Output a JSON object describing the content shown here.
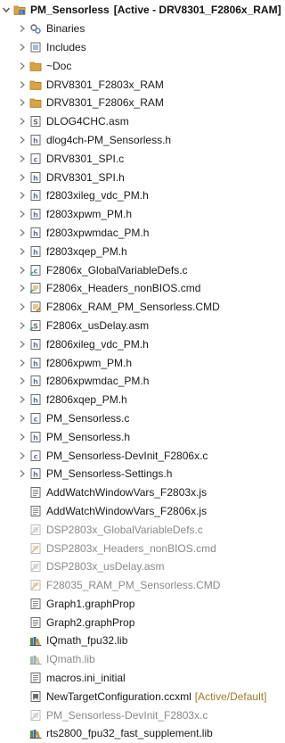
{
  "project": {
    "name": "PM_Sensorless",
    "status": "[Active - DRV8301_F2806x_RAM]",
    "icon": "project-icon"
  },
  "items": [
    {
      "label": "Binaries",
      "icon": "binaries-icon",
      "chevron": true,
      "ghost": false,
      "suffix": ""
    },
    {
      "label": "Includes",
      "icon": "includes-icon",
      "chevron": true,
      "ghost": false,
      "suffix": ""
    },
    {
      "label": "~Doc",
      "icon": "folder-icon",
      "chevron": true,
      "ghost": false,
      "suffix": ""
    },
    {
      "label": "DRV8301_F2803x_RAM",
      "icon": "folder-icon",
      "chevron": true,
      "ghost": false,
      "suffix": ""
    },
    {
      "label": "DRV8301_F2806x_RAM",
      "icon": "folder-icon",
      "chevron": true,
      "ghost": false,
      "suffix": ""
    },
    {
      "label": "DLOG4CHC.asm",
      "icon": "asm-file-icon",
      "chevron": true,
      "ghost": false,
      "suffix": ""
    },
    {
      "label": "dlog4ch-PM_Sensorless.h",
      "icon": "header-file-icon",
      "chevron": true,
      "ghost": false,
      "suffix": ""
    },
    {
      "label": "DRV8301_SPI.c",
      "icon": "c-file-icon",
      "chevron": true,
      "ghost": false,
      "suffix": ""
    },
    {
      "label": "DRV8301_SPI.h",
      "icon": "header-file-icon",
      "chevron": true,
      "ghost": false,
      "suffix": ""
    },
    {
      "label": "f2803xileg_vdc_PM.h",
      "icon": "header-file-icon",
      "chevron": true,
      "ghost": false,
      "suffix": ""
    },
    {
      "label": "f2803xpwm_PM.h",
      "icon": "header-file-icon",
      "chevron": true,
      "ghost": false,
      "suffix": ""
    },
    {
      "label": "f2803xpwmdac_PM.h",
      "icon": "header-file-icon",
      "chevron": true,
      "ghost": false,
      "suffix": ""
    },
    {
      "label": "f2803xqep_PM.h",
      "icon": "header-file-icon",
      "chevron": true,
      "ghost": false,
      "suffix": ""
    },
    {
      "label": "F2806x_GlobalVariableDefs.c",
      "icon": "linked-c-file-icon",
      "chevron": true,
      "ghost": false,
      "suffix": ""
    },
    {
      "label": "F2806x_Headers_nonBIOS.cmd",
      "icon": "linked-cmd-file-icon",
      "chevron": true,
      "ghost": false,
      "suffix": ""
    },
    {
      "label": "F2806x_RAM_PM_Sensorless.CMD",
      "icon": "cmd-file-icon",
      "chevron": true,
      "ghost": false,
      "suffix": ""
    },
    {
      "label": "F2806x_usDelay.asm",
      "icon": "linked-asm-file-icon",
      "chevron": true,
      "ghost": false,
      "suffix": ""
    },
    {
      "label": "f2806xileg_vdc_PM.h",
      "icon": "header-file-icon",
      "chevron": true,
      "ghost": false,
      "suffix": ""
    },
    {
      "label": "f2806xpwm_PM.h",
      "icon": "header-file-icon",
      "chevron": true,
      "ghost": false,
      "suffix": ""
    },
    {
      "label": "f2806xpwmdac_PM.h",
      "icon": "header-file-icon",
      "chevron": true,
      "ghost": false,
      "suffix": ""
    },
    {
      "label": "f2806xqep_PM.h",
      "icon": "header-file-icon",
      "chevron": true,
      "ghost": false,
      "suffix": ""
    },
    {
      "label": "PM_Sensorless.c",
      "icon": "c-file-icon",
      "chevron": true,
      "ghost": false,
      "suffix": ""
    },
    {
      "label": "PM_Sensorless.h",
      "icon": "header-file-icon",
      "chevron": true,
      "ghost": false,
      "suffix": ""
    },
    {
      "label": "PM_Sensorless-DevInit_F2806x.c",
      "icon": "c-file-icon",
      "chevron": true,
      "ghost": false,
      "suffix": ""
    },
    {
      "label": "PM_Sensorless-Settings.h",
      "icon": "header-file-icon",
      "chevron": true,
      "ghost": false,
      "suffix": ""
    },
    {
      "label": "AddWatchWindowVars_F2803x.js",
      "icon": "text-file-icon",
      "chevron": false,
      "ghost": false,
      "suffix": ""
    },
    {
      "label": "AddWatchWindowVars_F2806x.js",
      "icon": "text-file-icon",
      "chevron": false,
      "ghost": false,
      "suffix": ""
    },
    {
      "label": "DSP2803x_GlobalVariableDefs.c",
      "icon": "excluded-c-file-icon",
      "chevron": false,
      "ghost": true,
      "suffix": ""
    },
    {
      "label": "DSP2803x_Headers_nonBIOS.cmd",
      "icon": "excluded-cmd-file-icon",
      "chevron": false,
      "ghost": true,
      "suffix": ""
    },
    {
      "label": "DSP2803x_usDelay.asm",
      "icon": "excluded-asm-file-icon",
      "chevron": false,
      "ghost": true,
      "suffix": ""
    },
    {
      "label": "F28035_RAM_PM_Sensorless.CMD",
      "icon": "excluded-cmd-file-icon",
      "chevron": false,
      "ghost": true,
      "suffix": ""
    },
    {
      "label": "Graph1.graphProp",
      "icon": "text-file-icon",
      "chevron": false,
      "ghost": false,
      "suffix": ""
    },
    {
      "label": "Graph2.graphProp",
      "icon": "text-file-icon",
      "chevron": false,
      "ghost": false,
      "suffix": ""
    },
    {
      "label": "IQmath_fpu32.lib",
      "icon": "library-icon",
      "chevron": false,
      "ghost": false,
      "suffix": ""
    },
    {
      "label": "IQmath.lib",
      "icon": "library-icon",
      "chevron": false,
      "ghost": true,
      "suffix": ""
    },
    {
      "label": "macros.ini_initial",
      "icon": "text-file-icon",
      "chevron": false,
      "ghost": false,
      "suffix": ""
    },
    {
      "label": "NewTargetConfiguration.ccxml",
      "icon": "target-config-icon",
      "chevron": false,
      "ghost": false,
      "suffix": "[Active/Default]"
    },
    {
      "label": "PM_Sensorless-DevInit_F2803x.c",
      "icon": "excluded-c-file-icon",
      "chevron": false,
      "ghost": true,
      "suffix": ""
    },
    {
      "label": "rts2800_fpu32_fast_supplement.lib",
      "icon": "library-icon",
      "chevron": false,
      "ghost": false,
      "suffix": ""
    }
  ],
  "colors": {
    "folder": "#d9a441",
    "header": "#5b6fa8",
    "cfile": "#5b6fa8",
    "asm": "#6a6a6a",
    "cmd": "#c78a2a",
    "lib": "#3a6f3a",
    "chevron": "#7a7a7a"
  }
}
